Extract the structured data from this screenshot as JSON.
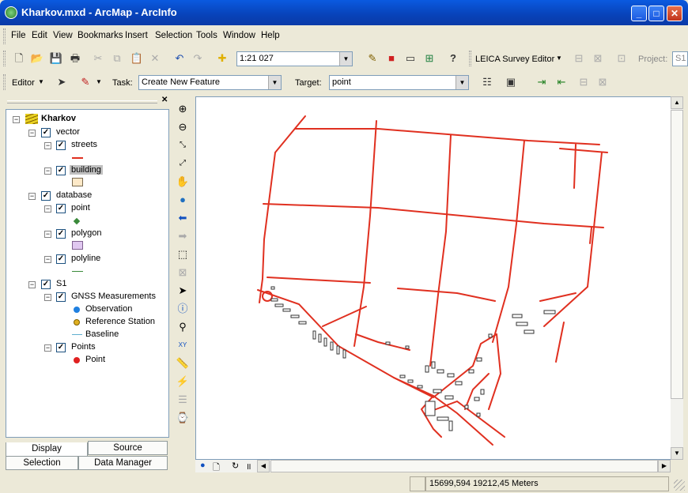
{
  "window": {
    "title": "Kharkov.mxd - ArcMap - ArcInfo",
    "minimize": "_",
    "maximize": "□",
    "close": "✕"
  },
  "menu": [
    "File",
    "Edit",
    "View",
    "Bookmarks",
    "Insert",
    "Selection",
    "Tools",
    "Window",
    "Help"
  ],
  "standard_toolbar": {
    "scale": "1:21 027",
    "leica_label": "LEICA Survey Editor",
    "project_label": "Project:",
    "project_value": "S1"
  },
  "editor_toolbar": {
    "editor_label": "Editor",
    "task_label": "Task:",
    "task_value": "Create New Feature",
    "target_label": "Target:",
    "target_value": "point"
  },
  "toc": {
    "root": "Kharkov",
    "groups": [
      {
        "name": "vector",
        "layers": [
          {
            "name": "streets"
          },
          {
            "name": "building"
          }
        ]
      },
      {
        "name": "database",
        "layers": [
          {
            "name": "point"
          },
          {
            "name": "polygon"
          },
          {
            "name": "polyline"
          }
        ]
      },
      {
        "name": "S1",
        "layers": [
          {
            "name": "GNSS Measurements",
            "legend": [
              "Observation",
              "Reference Station",
              "Baseline"
            ]
          },
          {
            "name": "Points",
            "legend": [
              "Point"
            ]
          }
        ]
      }
    ],
    "tabs": [
      "Display",
      "Source",
      "Selection",
      "Data Manager"
    ]
  },
  "status": {
    "coordinates": "15699,594  19212,45 Meters"
  },
  "colors": {
    "streets": "#e03020",
    "building_fill": "#fde9c8",
    "polygon_fill": "#e0c8f0",
    "point_green": "#3a8a3a",
    "observation": "#2080e0",
    "reference_station": "#e0b020",
    "baseline": "#60b0d0",
    "points_red": "#e02020"
  },
  "icons": [
    "zoom-in-icon",
    "zoom-out-icon",
    "fixed-zoom-in-icon",
    "fixed-zoom-out-icon",
    "pan-icon",
    "full-extent-icon",
    "back-icon",
    "forward-icon",
    "select-features-icon",
    "clear-selection-icon",
    "select-elements-icon",
    "identify-icon",
    "find-icon",
    "go-to-xy-icon",
    "measure-icon",
    "hyperlink-icon",
    "html-popup-icon",
    "time-slider-icon"
  ]
}
